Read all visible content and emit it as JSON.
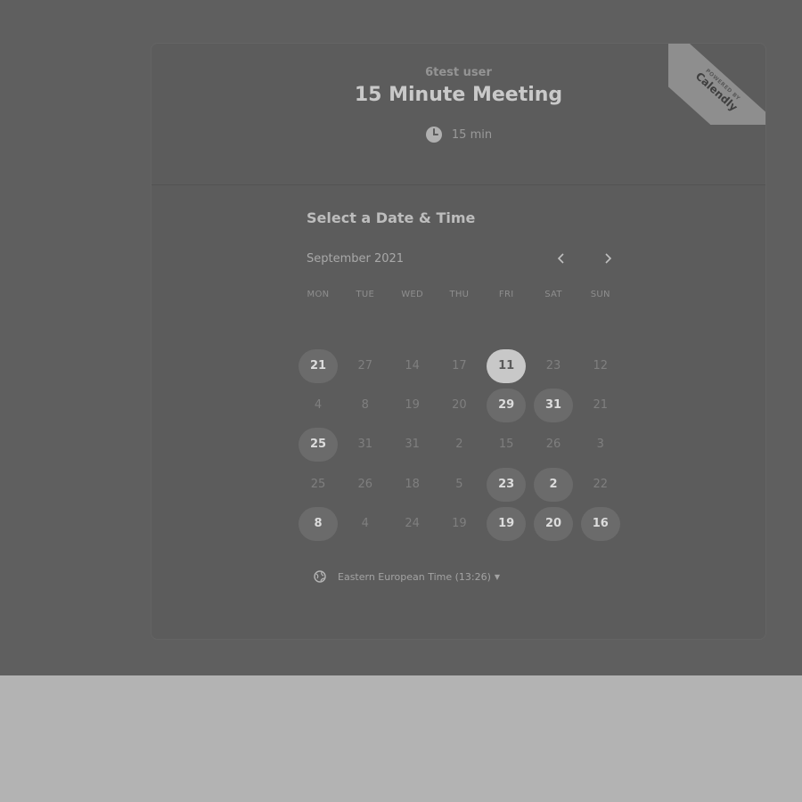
{
  "header": {
    "owner": "6test user",
    "title": "15 Minute Meeting",
    "duration": "15 min",
    "badge_small": "POWERED BY",
    "badge_brand": "Calendly"
  },
  "scheduler": {
    "section_title": "Select a Date & Time",
    "month": "September 2021",
    "prev_icon": "chevron-left-icon",
    "next_icon": "chevron-right-icon",
    "weekdays": [
      "MON",
      "TUE",
      "WED",
      "THU",
      "FRI",
      "SAT",
      "SUN"
    ],
    "weeks": [
      [
        {
          "label": "21",
          "state": "available"
        },
        {
          "label": "27",
          "state": "muted"
        },
        {
          "label": "14",
          "state": "muted"
        },
        {
          "label": "17",
          "state": "muted"
        },
        {
          "label": "11",
          "state": "selected"
        },
        {
          "label": "23",
          "state": "muted"
        },
        {
          "label": "12",
          "state": "muted"
        }
      ],
      [
        {
          "label": "4",
          "state": "muted"
        },
        {
          "label": "8",
          "state": "muted"
        },
        {
          "label": "19",
          "state": "muted"
        },
        {
          "label": "20",
          "state": "muted"
        },
        {
          "label": "29",
          "state": "available"
        },
        {
          "label": "31",
          "state": "available"
        },
        {
          "label": "21",
          "state": "muted"
        }
      ],
      [
        {
          "label": "25",
          "state": "available"
        },
        {
          "label": "31",
          "state": "muted"
        },
        {
          "label": "31",
          "state": "muted"
        },
        {
          "label": "2",
          "state": "muted"
        },
        {
          "label": "15",
          "state": "muted"
        },
        {
          "label": "26",
          "state": "muted"
        },
        {
          "label": "3",
          "state": "muted"
        }
      ],
      [
        {
          "label": "25",
          "state": "muted"
        },
        {
          "label": "26",
          "state": "muted"
        },
        {
          "label": "18",
          "state": "muted"
        },
        {
          "label": "5",
          "state": "muted"
        },
        {
          "label": "23",
          "state": "available"
        },
        {
          "label": "2",
          "state": "available"
        },
        {
          "label": "22",
          "state": "muted"
        }
      ],
      [
        {
          "label": "8",
          "state": "available"
        },
        {
          "label": "4",
          "state": "muted"
        },
        {
          "label": "24",
          "state": "muted"
        },
        {
          "label": "19",
          "state": "muted"
        },
        {
          "label": "19",
          "state": "available"
        },
        {
          "label": "20",
          "state": "available"
        },
        {
          "label": "16",
          "state": "available"
        }
      ]
    ],
    "timezone": "Eastern European Time (13:26)",
    "timezone_icon": "globe-icon"
  },
  "colors": {
    "page_bg": "#5f5f5f",
    "card_bg": "#5c5c5c",
    "available_bg": "#6b6b6b",
    "selected_bg": "#c8c8c8",
    "footer_bg": "#b3b3b3"
  }
}
